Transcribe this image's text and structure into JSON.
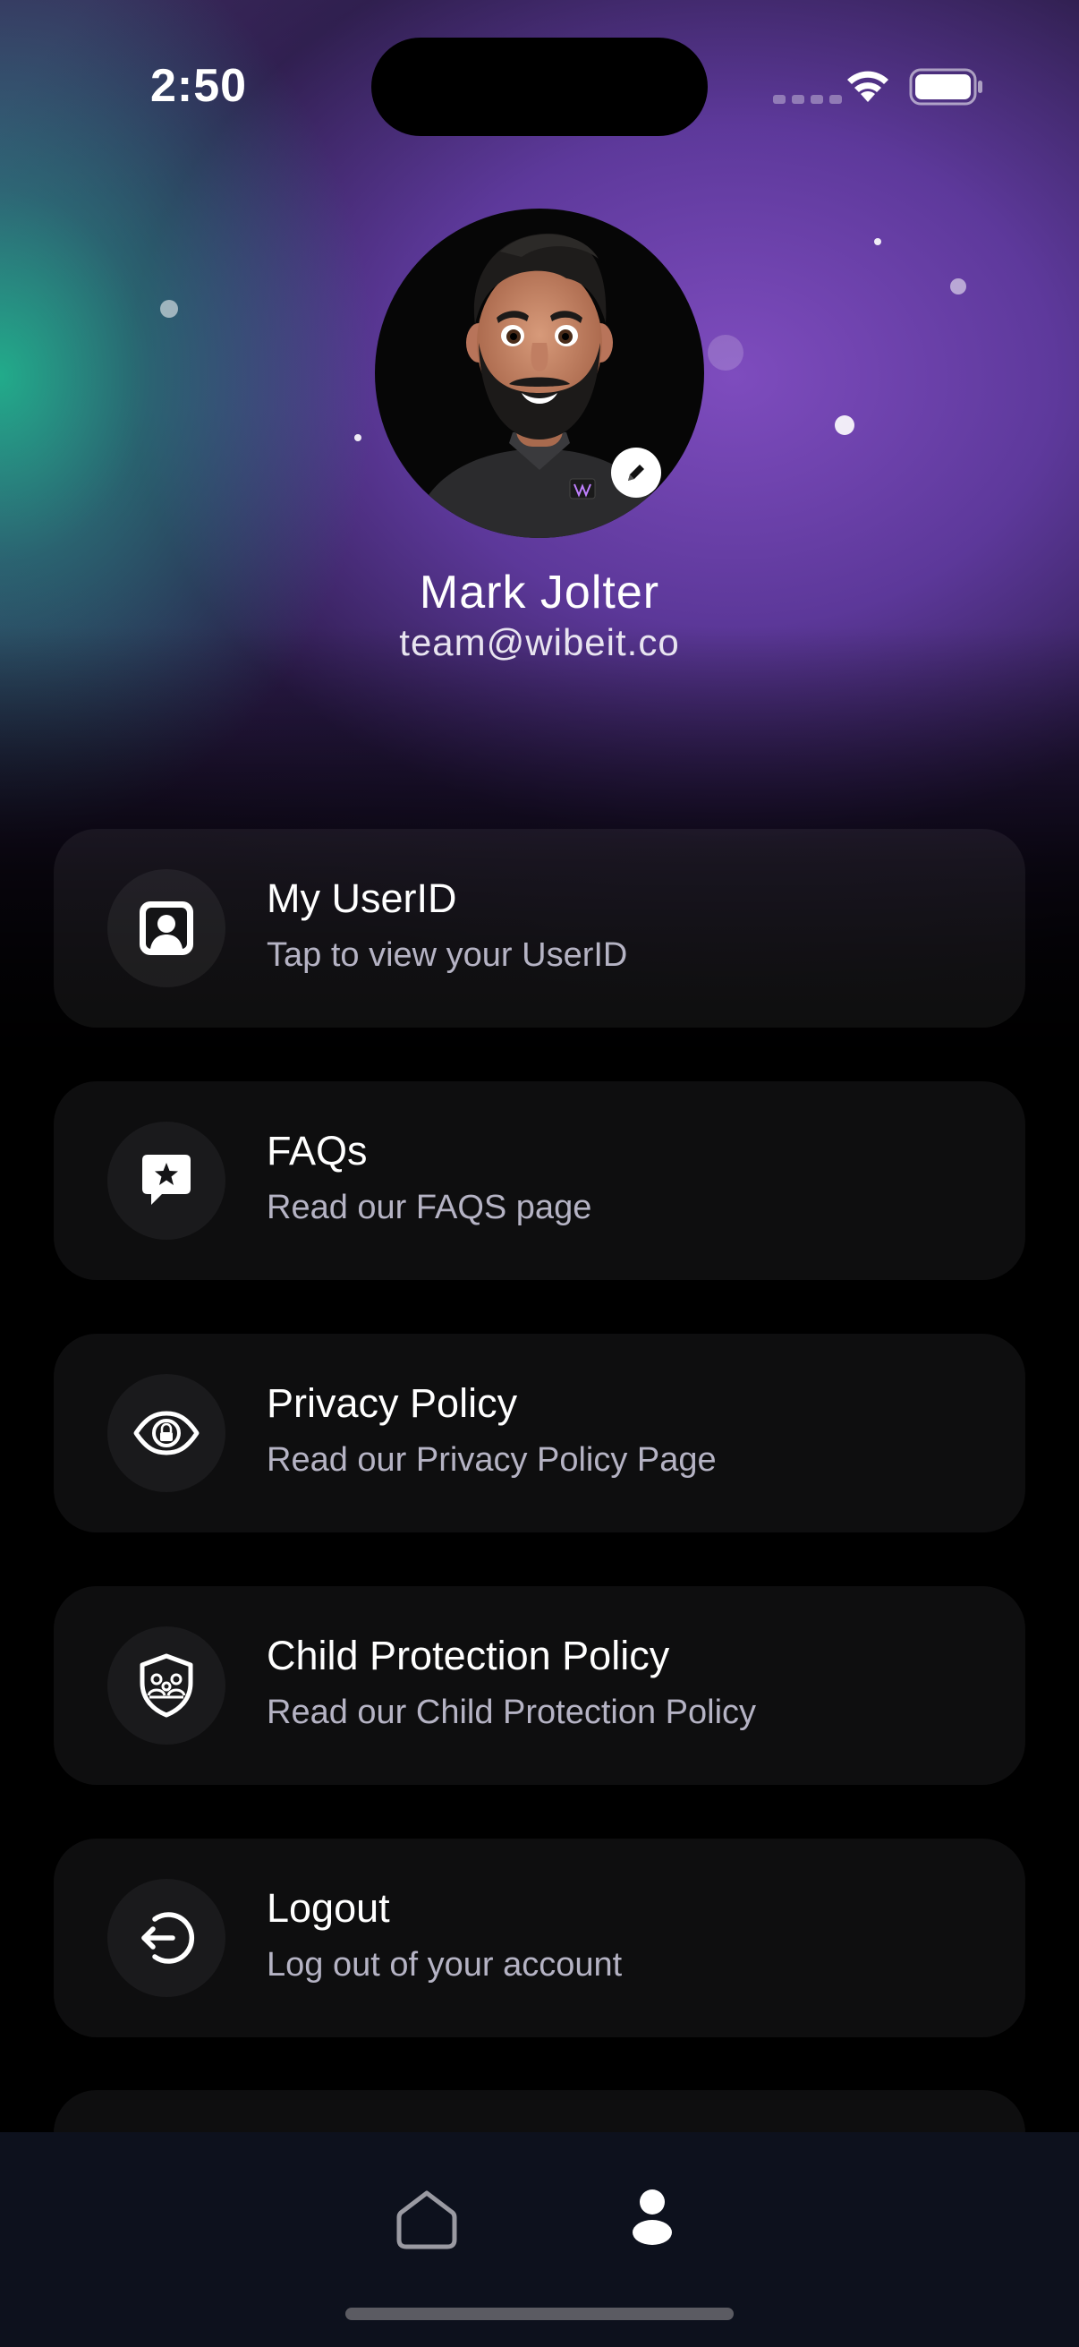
{
  "status_bar": {
    "time": "2:50"
  },
  "profile": {
    "name": "Mark Jolter",
    "email": "team@wibeit.co"
  },
  "menu": [
    {
      "title": "My UserID",
      "subtitle": "Tap to view your UserID",
      "icon": "user-id-icon"
    },
    {
      "title": "FAQs",
      "subtitle": "Read our FAQS page",
      "icon": "faq-star-icon"
    },
    {
      "title": "Privacy Policy",
      "subtitle": "Read our Privacy Policy Page",
      "icon": "privacy-eye-lock-icon"
    },
    {
      "title": "Child Protection Policy",
      "subtitle": "Read our Child Protection Policy",
      "icon": "shield-family-icon"
    },
    {
      "title": "Logout",
      "subtitle": "Log out of your account",
      "icon": "logout-icon"
    }
  ],
  "tab_bar": {
    "items": [
      {
        "name": "home",
        "icon": "home-icon"
      },
      {
        "name": "profile",
        "icon": "profile-icon",
        "active": true
      }
    ]
  },
  "colors": {
    "accent_purple": "#7e4cbe",
    "accent_teal": "#20b28c",
    "card_bg": "#0e0e0f",
    "subtitle_text": "#b5b3c4",
    "tabbar_bg": "#0d111d"
  }
}
